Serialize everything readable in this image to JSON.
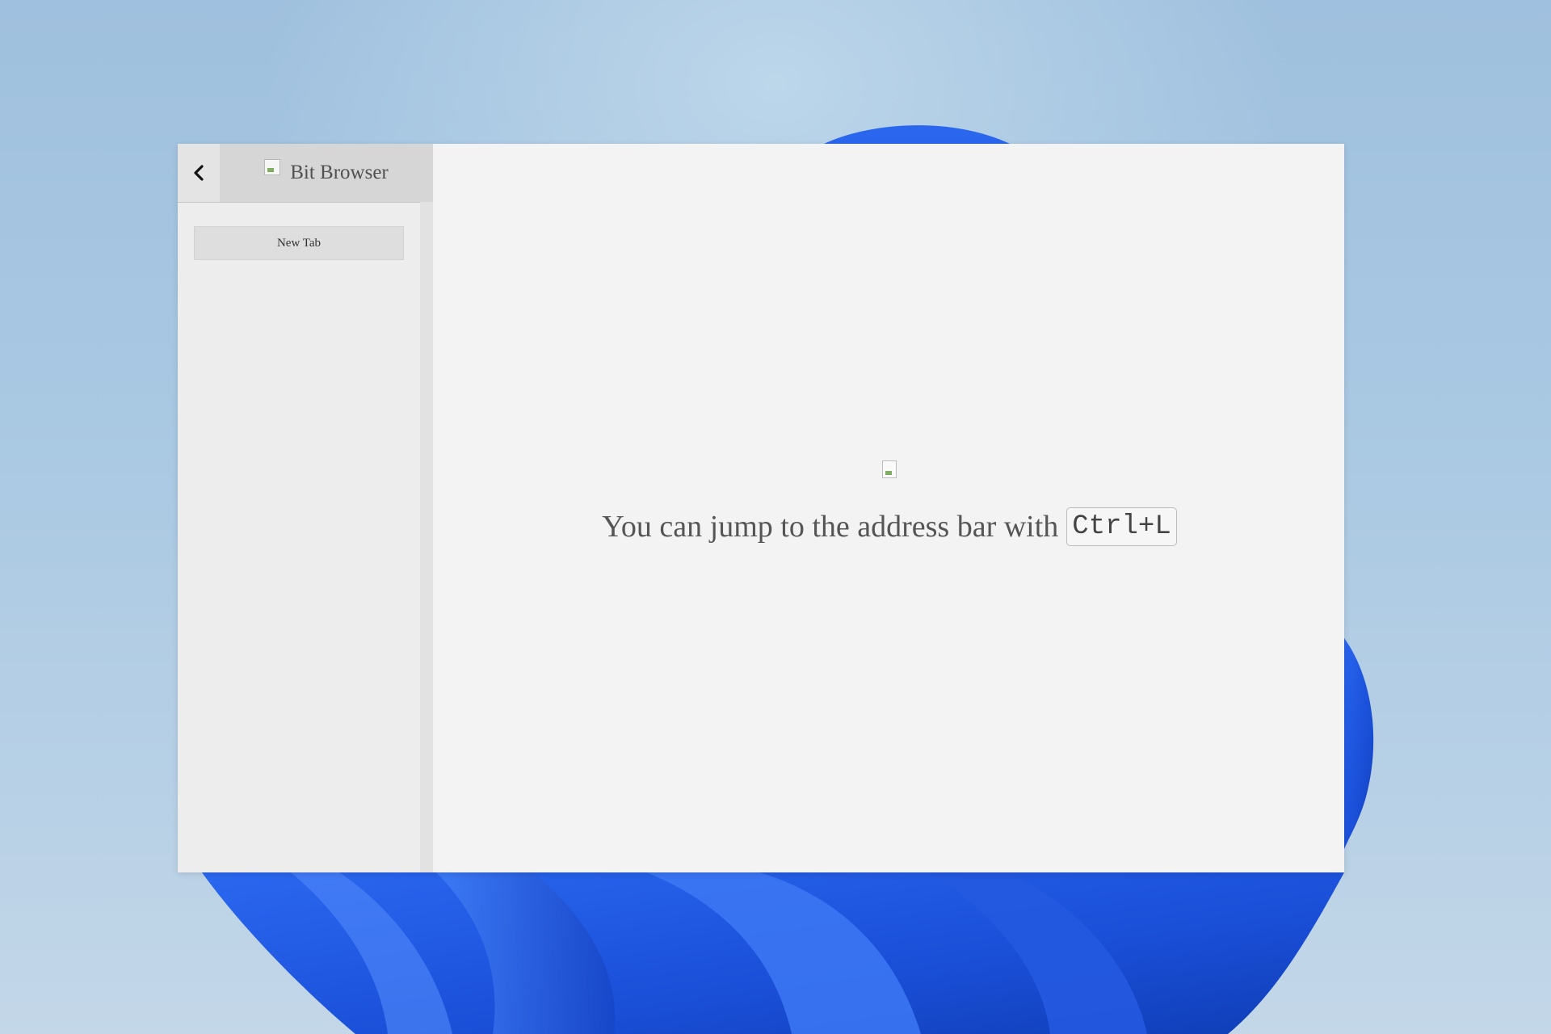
{
  "window": {
    "brand_title": "Bit Browser",
    "back_icon": "chevron-left-icon",
    "logo_icon": "broken-image-icon"
  },
  "sidebar": {
    "new_tab_label": "New Tab"
  },
  "main": {
    "hint_text": "You can jump to the address bar with",
    "shortcut": "Ctrl+L",
    "hero_icon": "broken-image-icon"
  },
  "colors": {
    "titlebar_bg": "#d6d6d6",
    "sidebar_bg": "#ededed",
    "content_bg": "#f3f3f3"
  }
}
